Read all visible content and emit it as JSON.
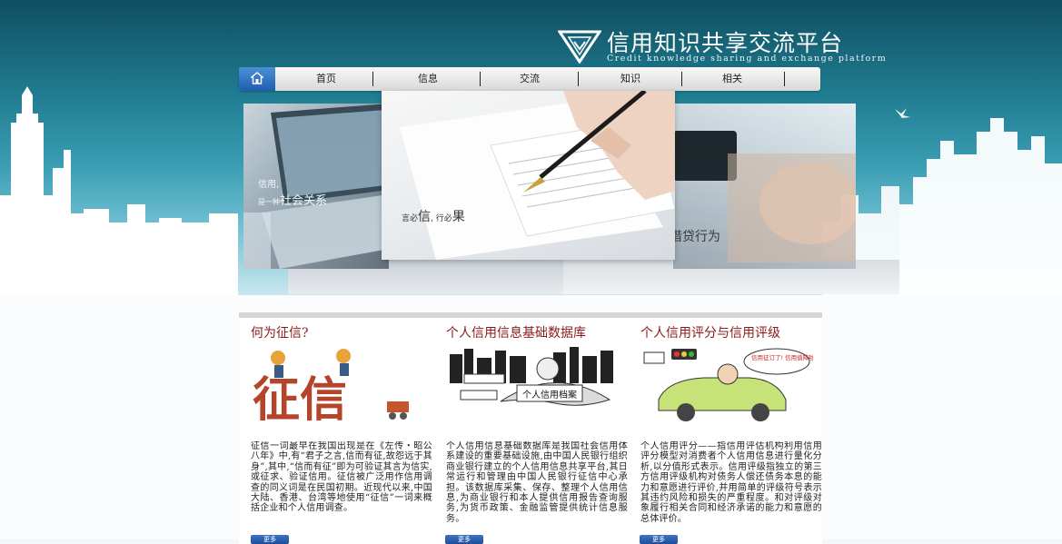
{
  "header": {
    "title_cn": "信用知识共享交流平台",
    "title_en": "Credit knowledge sharing and exchange platform"
  },
  "nav": {
    "home_icon": "home-icon",
    "items": [
      "首页",
      "信息",
      "交流",
      "知识",
      "相关"
    ]
  },
  "banner": {
    "captions": {
      "laptop_line1": "信用,",
      "laptop_line2_small": "是一种",
      "laptop_line2_big": "社会关系",
      "pen_small1": "言必",
      "pen_big1": "信",
      "pen_small2": ", 行必",
      "pen_big2": "果",
      "card": "借贷行为"
    }
  },
  "columns": [
    {
      "title": "何为征信?",
      "image_text": "征信",
      "text": "征信一词最早在我国出现是在《左传・昭公八年》中,有“君子之言,信而有征,故怨远于其身”,其中,“信而有征”即为可验证其言为信实,或征求、验证信用。征信被广泛用作信用调查的同义词是在民国初期。近现代以来,中国大陆、香港、台湾等地使用“征信”一词来概括企业和个人信用调查。",
      "more": "更多"
    },
    {
      "title": "个人信用信息基础数据库",
      "image_text": "个人信用档案",
      "text": "个人信用信息基础数据库是我国社会信用体系建设的重要基础设施,由中国人民银行组织商业银行建立的个人信用信息共享平台,其日常运行和管理由中国人民银行征信中心承担。该数据库采集、保存、整理个人信用信息,为商业银行和本人提供信用报告查询服务,为货币政策、金融监管提供统计信息服务。",
      "more": "更多"
    },
    {
      "title": "个人信用评分与信用评级",
      "image_text": "信用征订了! 信用值降啦!",
      "text": "个人信用评分——指信用评估机构利用信用评分模型对消费者个人信用信息进行量化分析,以分值形式表示。信用评级指独立的第三方信用评级机构对债务人偿还债务本息的能力和意愿进行评价,并用简单的评级符号表示其违约风险和损失的严重程度。和对评级对象履行相关合同和经济承诺的能力和意愿的总体评价。",
      "more": "更多"
    }
  ]
}
